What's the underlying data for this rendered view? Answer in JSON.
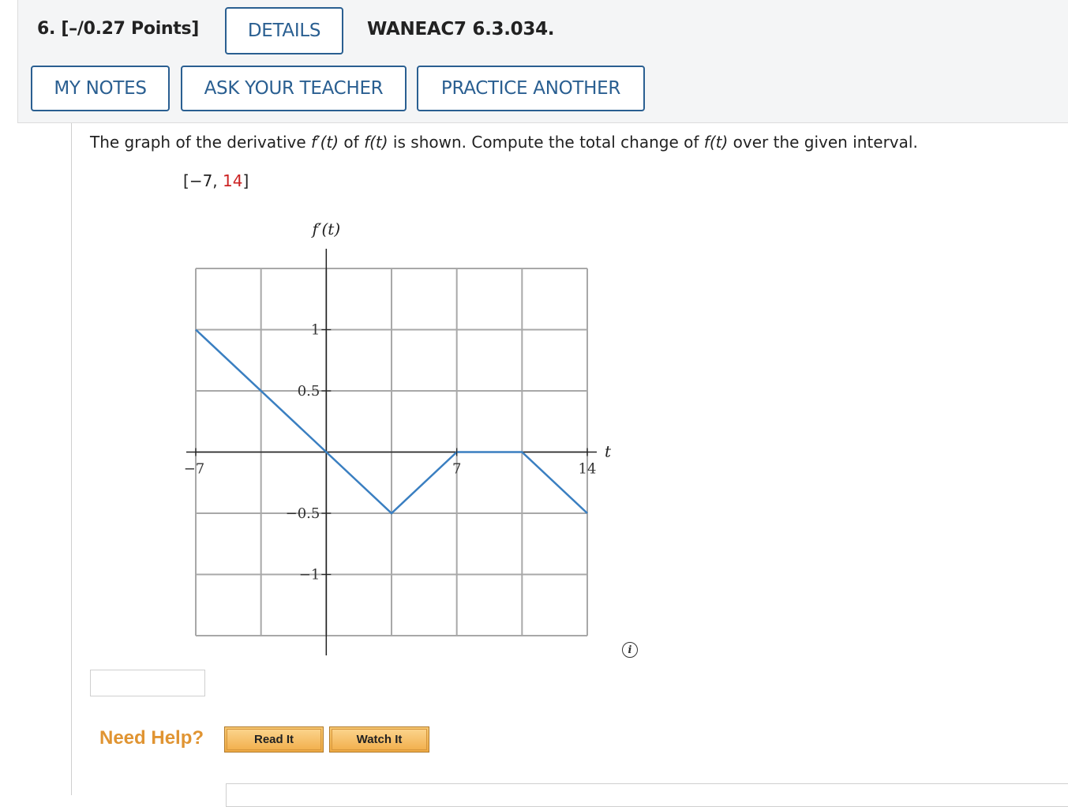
{
  "header": {
    "question_number": "6.  [–/0.27 Points]",
    "details_label": "DETAILS",
    "question_id": "WANEAC7 6.3.034.",
    "my_notes_label": "MY NOTES",
    "ask_teacher_label": "ASK YOUR TEACHER",
    "practice_label": "PRACTICE ANOTHER"
  },
  "problem": {
    "text_1": "The graph of the derivative ",
    "fprime_t": "f′(t)",
    "text_2": " of ",
    "f_t": "f(t)",
    "text_3": " is shown. Compute the total change of ",
    "f_t2": "f(t)",
    "text_4": " over the given interval.",
    "interval_open": "[",
    "interval_start": "−7",
    "interval_sep": ", ",
    "interval_end": "14",
    "interval_close": "]"
  },
  "chart_data": {
    "type": "line",
    "ylabel": "f′(t)",
    "xlabel": "t",
    "x_ticks": [
      -7,
      7,
      14
    ],
    "y_ticks": [
      1,
      0.5,
      -0.5,
      -1
    ],
    "xlim": [
      -7,
      14
    ],
    "ylim": [
      -1.5,
      1.5
    ],
    "grid": true,
    "series": [
      {
        "x": [
          -7,
          0,
          3.5,
          7,
          10.5,
          14
        ],
        "y": [
          1,
          0,
          -0.5,
          0,
          0,
          -0.5
        ]
      }
    ],
    "line_color": "#3a7fc1"
  },
  "answer": {
    "value": ""
  },
  "help": {
    "need_help": "Need Help?",
    "read_it": "Read It",
    "watch_it": "Watch It"
  },
  "colors": {
    "accent": "#2a5f91",
    "help_orange": "#e09432",
    "red": "#cc2222"
  }
}
